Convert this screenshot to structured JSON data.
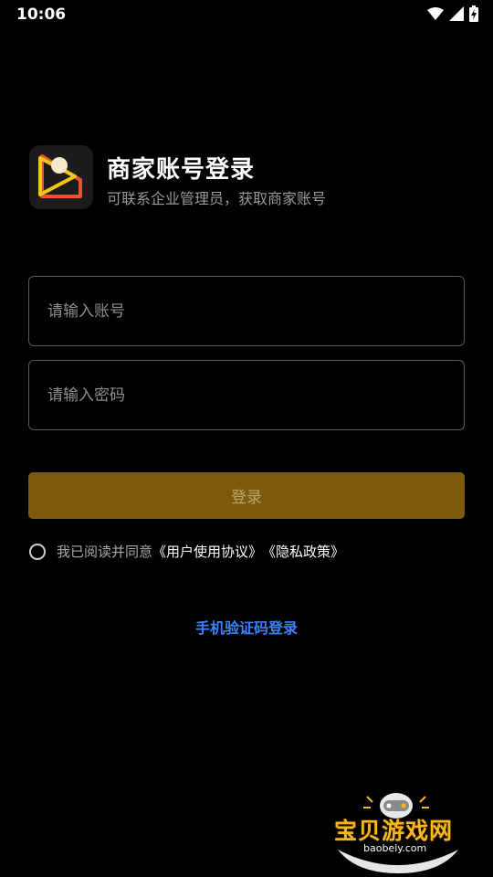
{
  "status_bar": {
    "time": "10:06",
    "icons": [
      "wifi-icon",
      "signal-icon",
      "battery-charging-icon"
    ]
  },
  "header": {
    "title": "商家账号登录",
    "subtitle": "可联系企业管理员，获取商家账号",
    "logo_icon": "merchant-logo-icon"
  },
  "form": {
    "account_placeholder": "请输入账号",
    "account_value": "",
    "password_placeholder": "请输入密码",
    "password_value": "",
    "login_label": "登录"
  },
  "agreement": {
    "prefix": "我已阅读并同意",
    "user_agreement": "《用户使用协议》",
    "privacy_policy": "《隐私政策》",
    "checked": false
  },
  "sms_login_label": "手机验证码登录",
  "watermark": {
    "title": "宝贝游戏网",
    "url": "baobeiy.com"
  },
  "colors": {
    "background": "#000000",
    "login_button": "#7b5a0c",
    "link_blue": "#3e82f7",
    "logo_accent": "#f5c518",
    "logo_orange": "#e8542b"
  }
}
